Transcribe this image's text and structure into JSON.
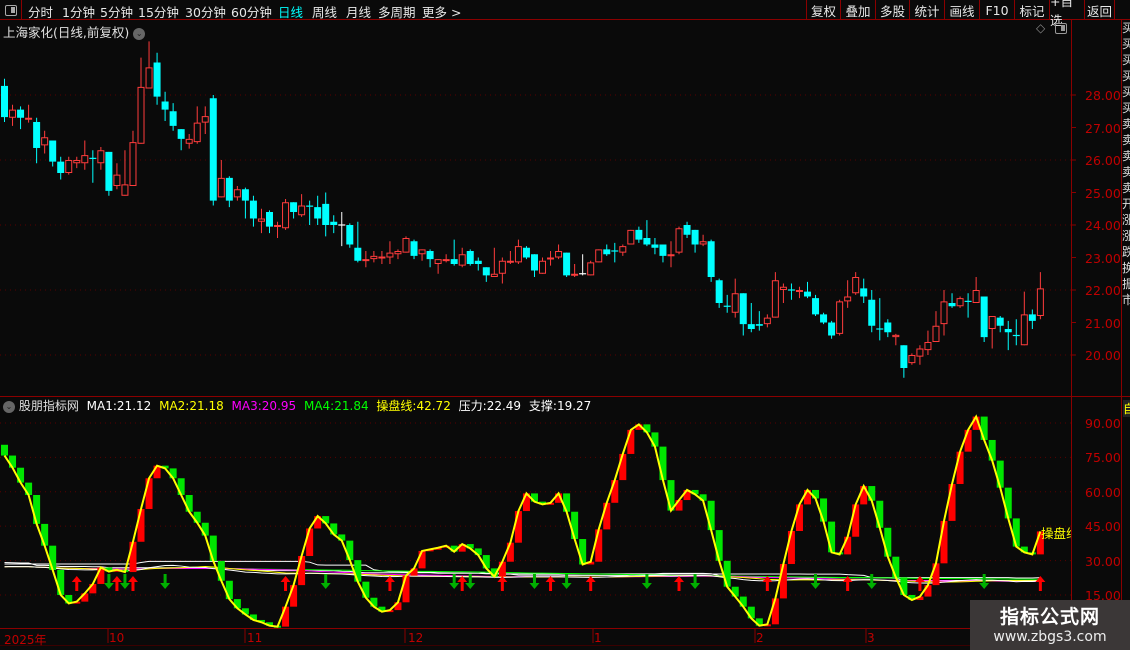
{
  "toolbar": {
    "periods": [
      "分时",
      "1分钟",
      "5分钟",
      "15分钟",
      "30分钟",
      "60分钟",
      "日线",
      "周线",
      "月线",
      "多周期",
      "更多 >"
    ],
    "active": "日线",
    "buttons": [
      "复权",
      "叠加",
      "多股",
      "统计",
      "画线",
      "F10",
      "标记",
      "+自选",
      "返回"
    ]
  },
  "chart": {
    "title": "上海家化(日线,前复权)",
    "price_ticks": [
      "28.00",
      "27.00",
      "26.00",
      "25.00",
      "24.00",
      "23.00",
      "22.00",
      "21.00",
      "20.00"
    ]
  },
  "indicator": {
    "name": "股朋指标网",
    "ma1_label": "MA1:",
    "ma1": "21.12",
    "ma2_label": "MA2:",
    "ma2": "21.18",
    "ma3_label": "MA3:",
    "ma3": "20.95",
    "ma4_label": "MA4:",
    "ma4": "21.84",
    "line_label": "操盘线:",
    "line_value": "42.72",
    "pressure_label": "压力:",
    "pressure": "22.49",
    "support_label": "支撑:",
    "support": "19.27",
    "end_label": "操盘线",
    "ticks": [
      "90.00",
      "75.00",
      "60.00",
      "45.00",
      "30.00",
      "15.00"
    ]
  },
  "dates": [
    "2025年",
    "10",
    "11",
    "12",
    "1",
    "2",
    "3"
  ],
  "side_strip": {
    "top_label": "自",
    "chars": [
      "买",
      "买",
      "买",
      "买",
      "买",
      "买",
      "卖",
      "卖",
      "卖",
      "卖",
      "卖",
      "开",
      "涨",
      "涨",
      "跌",
      "换",
      "振",
      "市"
    ]
  },
  "watermark": {
    "line1": "指标公式网",
    "line2": "www.zbgs3.com"
  },
  "colors": {
    "up": "#ff3c3c",
    "down": "#00ffff",
    "ind_up": "#ff0000",
    "ind_down": "#00e600",
    "line": "#ffff00",
    "ma1": "#ffffff",
    "ma2": "#ffff00",
    "ma3": "#ff00ff",
    "ma4": "#00ff00"
  },
  "chart_data": {
    "type": "candlestick",
    "ohlc_format": "[open,high,low,close]",
    "candles": [
      [
        28.28,
        28.5,
        27.17,
        27.32
      ],
      [
        27.3,
        27.7,
        27.05,
        27.55
      ],
      [
        27.55,
        27.65,
        26.95,
        27.3
      ],
      [
        27.25,
        27.7,
        27.15,
        27.3
      ],
      [
        27.17,
        27.3,
        25.9,
        26.37
      ],
      [
        26.45,
        26.9,
        26.2,
        26.7
      ],
      [
        26.6,
        26.6,
        25.8,
        25.95
      ],
      [
        25.95,
        26.1,
        25.4,
        25.6
      ],
      [
        25.6,
        26.1,
        25.55,
        26.0
      ],
      [
        25.9,
        26.1,
        25.75,
        26.0
      ],
      [
        25.9,
        26.6,
        25.7,
        26.15
      ],
      [
        26.05,
        26.3,
        25.3,
        26.05
      ],
      [
        25.9,
        26.4,
        25.7,
        26.3
      ],
      [
        26.25,
        26.25,
        24.9,
        25.05
      ],
      [
        25.2,
        25.9,
        25.1,
        25.55
      ],
      [
        24.9,
        26.3,
        24.9,
        25.25
      ],
      [
        25.2,
        26.9,
        25.2,
        26.55
      ],
      [
        26.5,
        29.15,
        26.5,
        28.25
      ],
      [
        28.2,
        29.65,
        28.2,
        28.85
      ],
      [
        29.0,
        29.3,
        27.7,
        27.95
      ],
      [
        27.8,
        28.1,
        27.2,
        27.55
      ],
      [
        27.5,
        27.75,
        26.9,
        27.05
      ],
      [
        26.95,
        26.95,
        26.3,
        26.65
      ],
      [
        26.5,
        26.8,
        26.35,
        26.65
      ],
      [
        26.55,
        27.65,
        26.5,
        27.15
      ],
      [
        27.15,
        27.65,
        26.8,
        27.35
      ],
      [
        27.9,
        28.0,
        24.6,
        24.75
      ],
      [
        24.85,
        26.0,
        24.85,
        25.45
      ],
      [
        25.45,
        25.5,
        24.55,
        24.75
      ],
      [
        24.85,
        25.2,
        24.75,
        25.1
      ],
      [
        25.1,
        25.15,
        24.2,
        24.75
      ],
      [
        24.75,
        24.9,
        23.95,
        24.2
      ],
      [
        24.1,
        24.5,
        23.75,
        24.2
      ],
      [
        24.4,
        24.45,
        23.75,
        23.95
      ],
      [
        23.95,
        24.1,
        23.6,
        24.0
      ],
      [
        23.9,
        24.8,
        23.85,
        24.7
      ],
      [
        24.7,
        24.7,
        24.2,
        24.4
      ],
      [
        24.3,
        24.95,
        24.25,
        24.6
      ],
      [
        24.58,
        24.75,
        24.0,
        24.58
      ],
      [
        24.55,
        24.9,
        24.0,
        24.2
      ],
      [
        24.65,
        25.0,
        23.65,
        24.0
      ],
      [
        24.1,
        24.3,
        23.75,
        24.0
      ],
      [
        24.0,
        24.4,
        23.35,
        24.0
      ],
      [
        24.0,
        24.05,
        23.3,
        23.4
      ],
      [
        23.3,
        24.1,
        22.85,
        22.9
      ],
      [
        22.9,
        23.2,
        22.7,
        22.95
      ],
      [
        22.95,
        23.2,
        22.85,
        23.05
      ],
      [
        23.0,
        23.2,
        22.8,
        23.03
      ],
      [
        23.0,
        23.5,
        22.8,
        23.15
      ],
      [
        23.1,
        23.25,
        22.95,
        23.2
      ],
      [
        23.15,
        23.65,
        23.15,
        23.6
      ],
      [
        23.5,
        23.55,
        22.95,
        23.05
      ],
      [
        23.1,
        23.25,
        22.9,
        23.25
      ],
      [
        23.2,
        23.25,
        22.7,
        22.95
      ],
      [
        22.8,
        22.95,
        22.5,
        22.95
      ],
      [
        22.9,
        23.1,
        22.85,
        22.95
      ],
      [
        22.95,
        23.55,
        22.75,
        22.8
      ],
      [
        22.75,
        23.3,
        22.7,
        23.1
      ],
      [
        23.2,
        23.25,
        22.75,
        22.8
      ],
      [
        22.9,
        23.0,
        22.6,
        22.8
      ],
      [
        22.7,
        22.7,
        22.25,
        22.45
      ],
      [
        22.4,
        23.3,
        22.4,
        22.5
      ],
      [
        22.5,
        23.0,
        22.2,
        22.9
      ],
      [
        22.85,
        23.2,
        22.8,
        22.9
      ],
      [
        22.85,
        23.55,
        22.8,
        23.35
      ],
      [
        23.3,
        23.35,
        22.95,
        23.0
      ],
      [
        23.1,
        23.1,
        22.4,
        22.6
      ],
      [
        22.5,
        23.0,
        22.5,
        22.9
      ],
      [
        22.95,
        23.2,
        22.75,
        23.0
      ],
      [
        23.0,
        23.4,
        22.95,
        23.2
      ],
      [
        23.15,
        23.15,
        22.4,
        22.45
      ],
      [
        22.45,
        22.8,
        22.4,
        22.5
      ],
      [
        22.5,
        23.1,
        22.45,
        22.5
      ],
      [
        22.45,
        22.9,
        22.45,
        22.85
      ],
      [
        22.85,
        23.25,
        22.85,
        23.25
      ],
      [
        23.25,
        23.4,
        23.05,
        23.1
      ],
      [
        23.2,
        23.45,
        22.85,
        23.2
      ],
      [
        23.15,
        23.4,
        23.05,
        23.35
      ],
      [
        23.4,
        23.85,
        23.4,
        23.85
      ],
      [
        23.85,
        23.95,
        23.45,
        23.55
      ],
      [
        23.6,
        24.15,
        23.35,
        23.4
      ],
      [
        23.4,
        23.6,
        23.1,
        23.3
      ],
      [
        23.4,
        23.4,
        22.85,
        23.05
      ],
      [
        23.05,
        23.5,
        22.7,
        23.1
      ],
      [
        23.15,
        23.95,
        23.1,
        23.9
      ],
      [
        24.0,
        24.1,
        23.6,
        23.7
      ],
      [
        23.85,
        23.85,
        23.15,
        23.4
      ],
      [
        23.4,
        23.7,
        23.35,
        23.5
      ],
      [
        23.5,
        23.55,
        22.25,
        22.4
      ],
      [
        22.3,
        22.35,
        21.45,
        21.6
      ],
      [
        21.5,
        21.85,
        21.3,
        21.5
      ],
      [
        21.3,
        22.35,
        21.15,
        21.9
      ],
      [
        21.9,
        21.9,
        20.6,
        20.95
      ],
      [
        20.95,
        21.6,
        20.7,
        20.8
      ],
      [
        20.95,
        21.35,
        20.75,
        20.9
      ],
      [
        20.95,
        21.25,
        20.85,
        21.15
      ],
      [
        21.15,
        22.55,
        21.15,
        22.3
      ],
      [
        22.0,
        22.2,
        21.6,
        22.1
      ],
      [
        22.0,
        22.2,
        21.7,
        22.0
      ],
      [
        21.95,
        22.1,
        21.75,
        22.0
      ],
      [
        21.95,
        22.25,
        21.75,
        21.8
      ],
      [
        21.75,
        21.85,
        21.2,
        21.25
      ],
      [
        21.25,
        21.3,
        20.95,
        21.0
      ],
      [
        21.0,
        21.05,
        20.5,
        20.6
      ],
      [
        20.65,
        21.7,
        20.6,
        21.65
      ],
      [
        21.65,
        22.3,
        21.45,
        21.8
      ],
      [
        21.9,
        22.55,
        21.85,
        22.4
      ],
      [
        22.05,
        22.35,
        21.6,
        21.8
      ],
      [
        21.7,
        22.0,
        20.7,
        20.9
      ],
      [
        20.8,
        21.75,
        20.45,
        20.8
      ],
      [
        21.0,
        21.1,
        20.55,
        20.7
      ],
      [
        20.55,
        20.65,
        20.3,
        20.62
      ],
      [
        20.3,
        20.3,
        19.3,
        19.6
      ],
      [
        19.75,
        20.05,
        19.7,
        20.0
      ],
      [
        19.95,
        20.3,
        19.7,
        20.2
      ],
      [
        20.15,
        20.75,
        20.0,
        20.4
      ],
      [
        20.4,
        21.35,
        20.4,
        20.9
      ],
      [
        20.95,
        22.0,
        20.6,
        21.65
      ],
      [
        21.6,
        21.9,
        21.45,
        21.5
      ],
      [
        21.5,
        21.8,
        21.45,
        21.75
      ],
      [
        21.65,
        21.9,
        21.15,
        21.65
      ],
      [
        21.6,
        22.4,
        21.6,
        22.0
      ],
      [
        21.8,
        21.8,
        20.4,
        20.55
      ],
      [
        20.8,
        21.2,
        20.2,
        21.2
      ],
      [
        21.15,
        21.2,
        20.7,
        20.9
      ],
      [
        20.8,
        21.05,
        20.15,
        20.7
      ],
      [
        20.6,
        21.1,
        20.3,
        20.6
      ],
      [
        20.3,
        21.95,
        20.3,
        21.25
      ],
      [
        21.25,
        21.4,
        20.8,
        21.05
      ],
      [
        21.2,
        22.55,
        21.1,
        22.05
      ]
    ],
    "price_range": [
      19.0,
      30.0
    ],
    "indicator_start": 80.5,
    "indicator": [
      75.8,
      70.5,
      64,
      58.6,
      46,
      36.5,
      25.9,
      15,
      11.3,
      12.1,
      15.7,
      19.8,
      27,
      25.2,
      26,
      25,
      38.2,
      52.5,
      65.9,
      71.4,
      70.2,
      65.9,
      58.6,
      51.3,
      46.5,
      40.9,
      29.8,
      21.2,
      13.2,
      9.2,
      6.5,
      4.1,
      3.1,
      1.6,
      1.2,
      9.9,
      19.3,
      32,
      44,
      49.4,
      46.2,
      41.4,
      38.7,
      30.2,
      20.8,
      13.8,
      9.9,
      7.7,
      8.4,
      11.8,
      23.4,
      26.6,
      34.2,
      34.9,
      35.6,
      36.5,
      33.9,
      37.2,
      35.3,
      32.4,
      26.6,
      23,
      29.5,
      37.8,
      51.6,
      59.3,
      55.7,
      54.5,
      55.2,
      59.3,
      51.3,
      39.4,
      28.3,
      29.5,
      43.6,
      55.2,
      65.1,
      76.5,
      87,
      89.4,
      85.9,
      79.7,
      65.1,
      51.8,
      56.4,
      60.8,
      58.9,
      56.1,
      43.3,
      29.9,
      18.6,
      14.3,
      9.9,
      4.8,
      1.6,
      2.2,
      13.5,
      28.5,
      42.9,
      54.5,
      60.8,
      57.1,
      47,
      33.6,
      32.7,
      40.4,
      54.5,
      62.5,
      56.1,
      44.3,
      31.7,
      22.7,
      15,
      12.8,
      14.3,
      19.3,
      28.8,
      47.3,
      63.4,
      77.5,
      87,
      92.8,
      82.6,
      73.6,
      61.8,
      48.4,
      36.1,
      33.6,
      32.7,
      42.72
    ],
    "indicator_range": [
      0,
      100
    ]
  }
}
